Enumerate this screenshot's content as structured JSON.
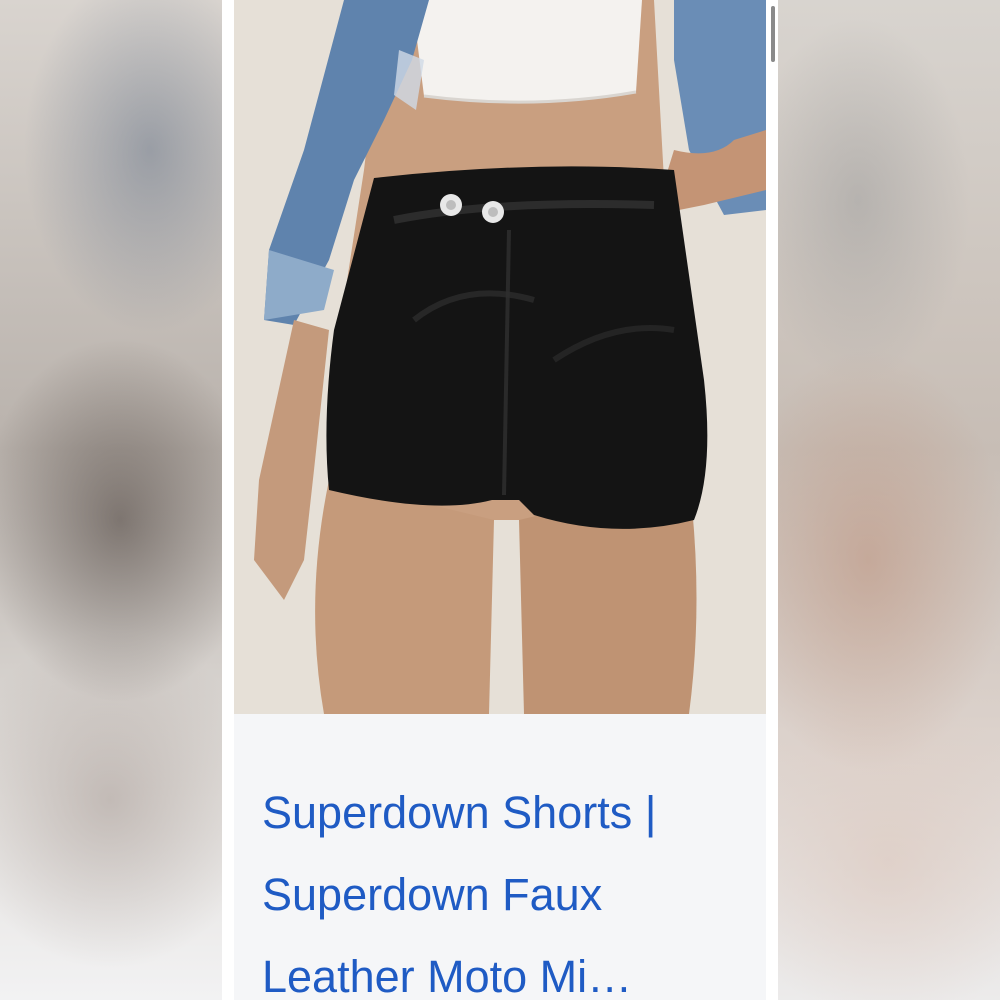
{
  "product": {
    "title": "Superdown Shorts | Superdown Faux Leather Moto Mi…"
  },
  "photo": {
    "icon": "product-photo"
  },
  "colors": {
    "link": "#1f5bc4",
    "caption_background": "#f5f6f8"
  }
}
